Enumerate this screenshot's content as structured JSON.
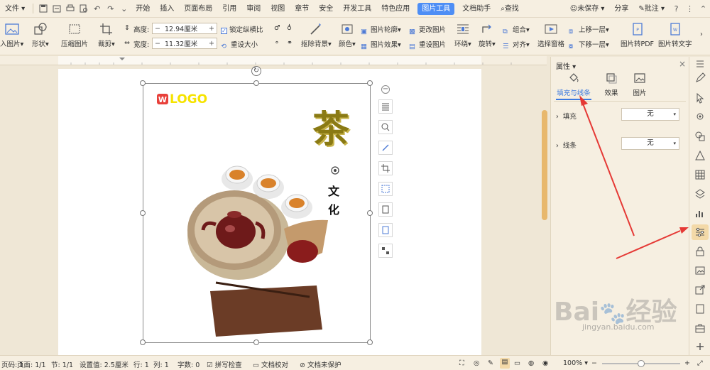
{
  "tabbar": {
    "file_menu": "文件",
    "tabs": [
      "开始",
      "插入",
      "页面布局",
      "引用",
      "审阅",
      "视图",
      "章节",
      "安全",
      "开发工具",
      "特色应用"
    ],
    "active_tab": "图片工具",
    "after_tabs": [
      "文档助手"
    ],
    "search": "查找",
    "unsaved": "未保存",
    "share": "分享",
    "annotate": "批注"
  },
  "ribbon": {
    "insert_picture": "入图片",
    "shape": "形状",
    "compress": "压缩图片",
    "crop": "裁剪",
    "height_label": "高度:",
    "height_value": "12.94厘米",
    "width_label": "宽度:",
    "width_value": "11.32厘米",
    "lock_ratio": "锁定纵横比",
    "reset_size": "重设大小",
    "remove_bg": "抠除背景",
    "color": "颜色",
    "picture_outline": "图片轮廓",
    "picture_effect": "图片效果",
    "change_picture": "更改图片",
    "reset_picture": "重设图片",
    "wrap": "环绕",
    "rotate": "旋转",
    "group": "组合",
    "align": "对齐",
    "selection_pane": "选择窗格",
    "bring_forward": "上移一层",
    "send_backward": "下移一层",
    "to_pdf": "图片转PDF",
    "to_text": "图片转文字"
  },
  "canvas": {
    "logo_text": "LOGO",
    "title_char": "茶",
    "subtitle_1": "文",
    "subtitle_2": "化"
  },
  "panel": {
    "title": "属性",
    "tabs": [
      "填充与线条",
      "效果",
      "图片"
    ],
    "fill_label": "填充",
    "fill_value": "无",
    "line_label": "线条",
    "line_value": "无"
  },
  "statusbar": {
    "page_num": "页码: 1",
    "pages": "页面: 1/1",
    "section": "节: 1/1",
    "setting": "设置值: 2.5厘米",
    "row": "行: 1",
    "col": "列: 1",
    "word_count": "字数: 0",
    "spell_check": "拼写检查",
    "doc_proof": "文档校对",
    "unprotected": "文档未保护",
    "zoom": "100%"
  },
  "watermark": {
    "brand": "Bai",
    "brand2": "经验",
    "url": "jingyan.baidu.com"
  },
  "colors": {
    "accent": "#4e8ef5",
    "arrow": "#e53935",
    "chrome": "#f6efe1",
    "logo_yellow": "#f6e300",
    "logo_red": "#e8403a"
  }
}
